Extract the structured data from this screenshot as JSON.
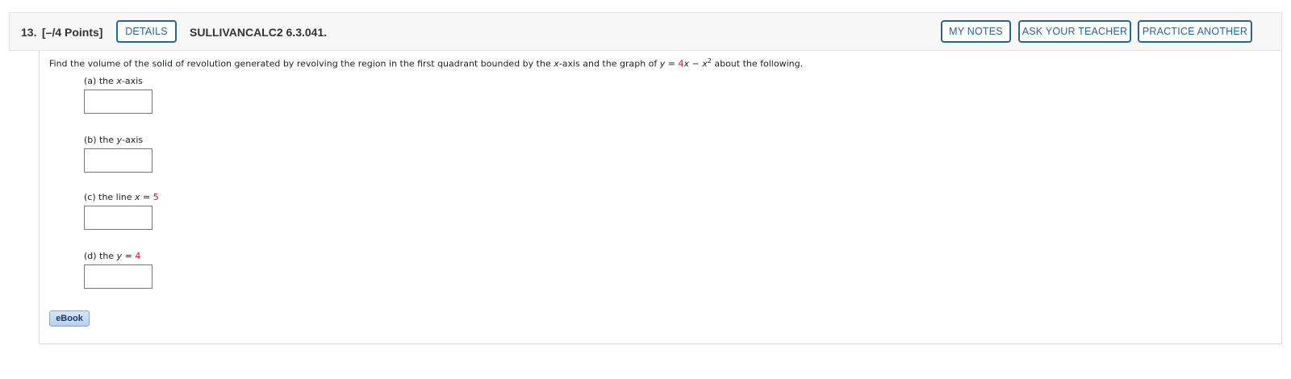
{
  "header": {
    "number": "13.",
    "points": "[–/4 Points]",
    "details_label": "DETAILS",
    "question_id": "SULLIVANCALC2 6.3.041.",
    "my_notes_label": "MY NOTES",
    "ask_teacher_label": "ASK YOUR TEACHER",
    "practice_label": "PRACTICE ANOTHER"
  },
  "prompt": {
    "text_1": "Find the volume of the solid of revolution generated by revolving the region in the first quadrant bounded by the ",
    "x_var": "x",
    "text_2": "-axis and the graph of ",
    "y_var": "y",
    "eq": " = ",
    "coef": "4",
    "x_var2": "x",
    "minus": " − ",
    "x_var3": "x",
    "exp": "2",
    "text_3": " about the following."
  },
  "parts": [
    {
      "prefix": "(a) the ",
      "var": "x",
      "suffix": "-axis",
      "value": ""
    },
    {
      "prefix": "(b) the ",
      "var": "y",
      "suffix": "-axis",
      "value": ""
    },
    {
      "prefix": "(c) the line ",
      "var": "x",
      "suffix": " = ",
      "num": "5",
      "value": ""
    },
    {
      "prefix": "(d) the ",
      "var": "y",
      "suffix": " = ",
      "num": "4",
      "value": ""
    }
  ],
  "ebook_label": "eBook",
  "colors": {
    "accent": "#2a6496",
    "highlight_red": "#c8102e"
  }
}
